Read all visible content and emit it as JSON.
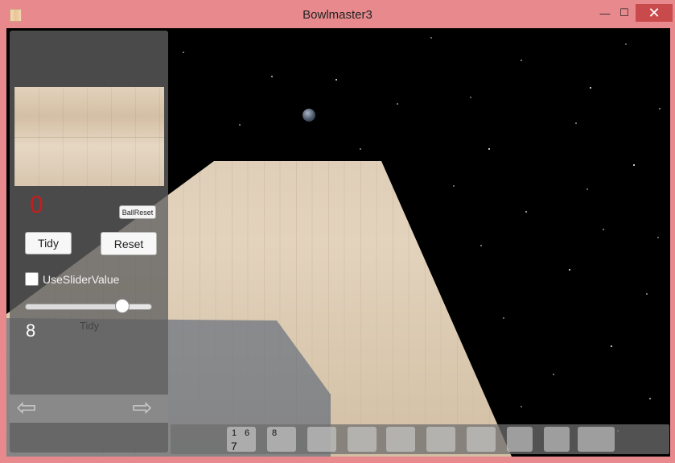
{
  "window": {
    "title": "Bowlmaster3",
    "controls": {
      "minimize": "—",
      "maximize": "☐",
      "close": "✕"
    }
  },
  "panel": {
    "score_digit": "0",
    "ballreset_label": "BallReset",
    "tidy_label": "Tidy",
    "reset_label": "Reset",
    "checkbox_label": "UseSliderValue",
    "checkbox_checked": false,
    "slider_value_fraction": 0.8,
    "slider_value_text": "8",
    "slider_caption": "Tidy"
  },
  "scoreboard": {
    "frames": [
      {
        "r1": "1",
        "r2": "6",
        "total": "7"
      },
      {
        "r1": "8",
        "r2": "",
        "total": ""
      },
      {
        "r1": "",
        "r2": "",
        "total": ""
      },
      {
        "r1": "",
        "r2": "",
        "total": ""
      },
      {
        "r1": "",
        "r2": "",
        "total": ""
      },
      {
        "r1": "",
        "r2": "",
        "total": ""
      },
      {
        "r1": "",
        "r2": "",
        "total": ""
      },
      {
        "r1": "",
        "r2": "",
        "total": ""
      },
      {
        "r1": "",
        "r2": "",
        "total": ""
      },
      {
        "r1": "",
        "r2": "",
        "total": ""
      }
    ]
  },
  "colors": {
    "titlebar": "#e88a8d",
    "score_red": "#c81c1c",
    "space": "#000000"
  },
  "icons": {
    "arrow_left": "arrow-left-icon",
    "arrow_right": "arrow-right-icon"
  }
}
